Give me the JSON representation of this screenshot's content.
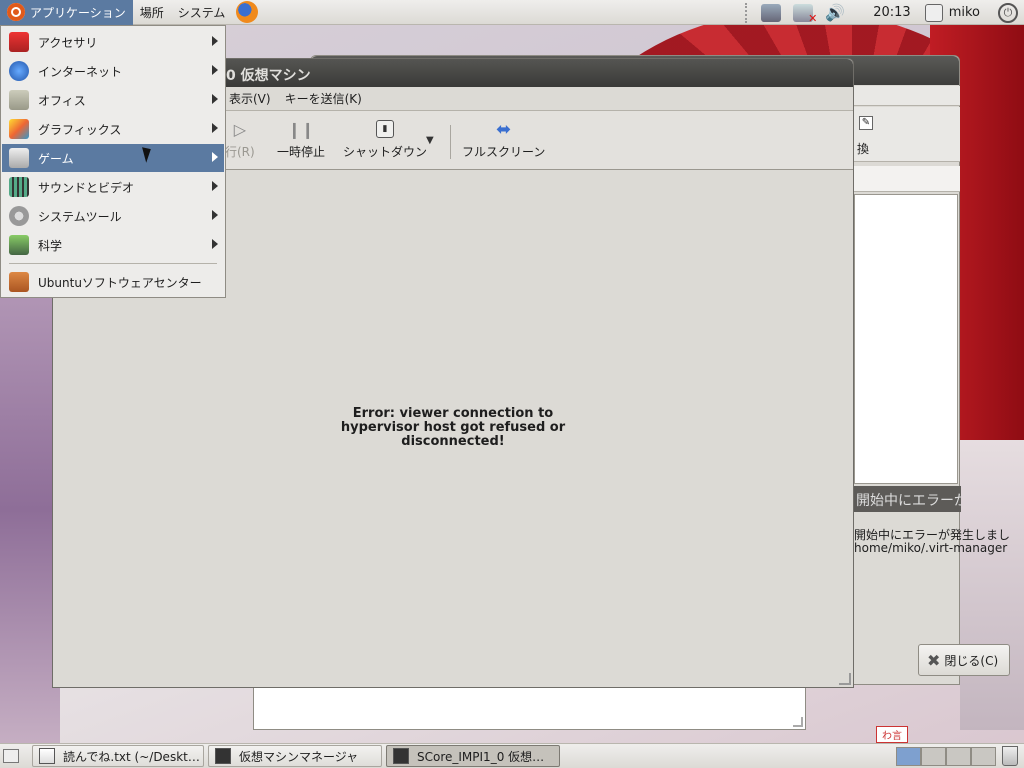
{
  "top_panel": {
    "applications": "アプリケーション",
    "places": "場所",
    "system": "システム",
    "clock": "20:13",
    "user": "miko"
  },
  "apps_menu": {
    "items": [
      {
        "label": "アクセサリ",
        "icon": "accessories-icon",
        "submenu": true
      },
      {
        "label": "インターネット",
        "icon": "internet-icon",
        "submenu": true
      },
      {
        "label": "オフィス",
        "icon": "office-icon",
        "submenu": true
      },
      {
        "label": "グラフィックス",
        "icon": "graphics-icon",
        "submenu": true
      },
      {
        "label": "ゲーム",
        "icon": "games-icon",
        "submenu": true,
        "highlighted": true
      },
      {
        "label": "サウンドとビデオ",
        "icon": "sound-video-icon",
        "submenu": true
      },
      {
        "label": "システムツール",
        "icon": "system-tools-icon",
        "submenu": true
      },
      {
        "label": "科学",
        "icon": "science-icon",
        "submenu": true
      }
    ],
    "software_center": "Ubuntuソフトウェアセンター"
  },
  "vm_window": {
    "title": "0 仮想マシン",
    "menu": [
      "表示(V)",
      "キーを送信(K)"
    ],
    "toolbar": {
      "run": "行(R)",
      "pause": "一時停止",
      "shutdown": "シャットダウン",
      "fullscreen": "フルスクリーン"
    },
    "error_lines": [
      "Error: viewer connection to",
      "hypervisor host got refused or",
      "disconnected!"
    ]
  },
  "bg_window": {
    "replace_label": "換",
    "error_title": "開始中にエラーが発",
    "error_line1": "開始中にエラーが発生しまし",
    "error_line2": "home/miko/.virt-manager",
    "close_button": "閉じる(C)"
  },
  "taskbar": {
    "tasks": [
      {
        "label": "読んでね.txt (~/Deskt…",
        "icon": "text-file-icon",
        "active": false
      },
      {
        "label": "仮想マシンマネージャ",
        "icon": "vm-manager-icon",
        "active": false
      },
      {
        "label": "SCore_IMPI1_0 仮想…",
        "icon": "vm-console-icon",
        "active": true
      }
    ]
  },
  "wallpaper": {
    "badge": "わ言"
  }
}
